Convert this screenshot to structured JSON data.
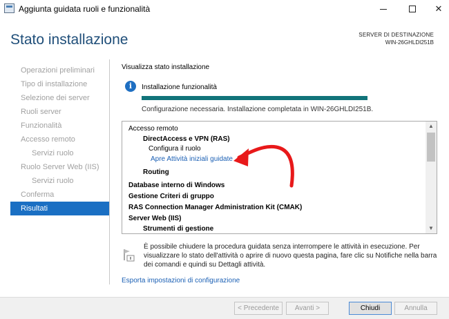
{
  "window": {
    "title": "Aggiunta guidata ruoli e funzionalità",
    "min_glyph": "",
    "close_glyph": "✕"
  },
  "header": {
    "title": "Stato installazione",
    "dest_label": "SERVER DI DESTINAZIONE",
    "dest_server": "WIN-26GHLDI251B"
  },
  "nav": {
    "items": [
      {
        "label": "Operazioni preliminari"
      },
      {
        "label": "Tipo di installazione"
      },
      {
        "label": "Selezione dei server"
      },
      {
        "label": "Ruoli server"
      },
      {
        "label": "Funzionalità"
      },
      {
        "label": "Accesso remoto"
      },
      {
        "label": "Servizi ruolo"
      },
      {
        "label": "Ruolo Server Web (IIS)"
      },
      {
        "label": "Servizi ruolo"
      },
      {
        "label": "Conferma"
      },
      {
        "label": "Risultati"
      }
    ]
  },
  "main": {
    "view_label": "Visualizza stato installazione",
    "info_icon": "i",
    "info_title": "Installazione funzionalità",
    "progress_fraction": 1.0,
    "status": "Configurazione necessaria. Installazione completata in WIN-26GHLDI251B.",
    "results": [
      {
        "text": "Accesso remoto",
        "style": "normal",
        "indent": 0
      },
      {
        "text": "DirectAccess e VPN (RAS)",
        "style": "bold",
        "indent": 1
      },
      {
        "text": "Configura il ruolo",
        "style": "normal",
        "indent": 2
      },
      {
        "text": "Apre Attività iniziali guidate",
        "style": "link",
        "indent": 2
      },
      {
        "text": "Routing",
        "style": "bold",
        "indent": 1
      },
      {
        "text": "Database interno di Windows",
        "style": "bold",
        "indent": 0
      },
      {
        "text": "Gestione Criteri di gruppo",
        "style": "bold",
        "indent": 0
      },
      {
        "text": "RAS Connection Manager Administration Kit (CMAK)",
        "style": "bold",
        "indent": 0
      },
      {
        "text": "Server Web (IIS)",
        "style": "bold",
        "indent": 0
      },
      {
        "text": "Strumenti di gestione",
        "style": "bold",
        "indent": 1
      }
    ],
    "scroll_up": "▲",
    "scroll_down": "▼",
    "note": "È possibile chiudere la procedura guidata senza interrompere le attività in esecuzione. Per visualizzare lo stato dell'attività o aprire di nuovo questa pagina, fare clic su Notifiche nella barra dei comandi e quindi su Dettagli attività.",
    "export_link": "Esporta impostazioni di configurazione"
  },
  "footer": {
    "prev": "< Precedente",
    "next": "Avanti >",
    "close": "Chiudi",
    "cancel": "Annulla"
  },
  "colors": {
    "accent": "#1a6fc3",
    "title": "#1f4e79",
    "progress": "#11747a",
    "link": "#1a5fb4",
    "annotation_arrow": "#e8191a"
  }
}
